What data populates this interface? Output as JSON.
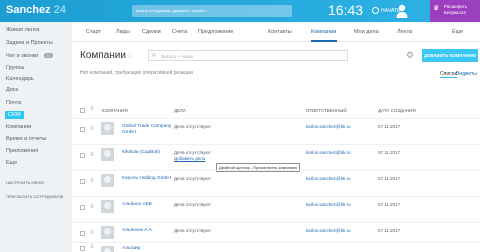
{
  "app": {
    "logo_name": "Sanchez",
    "logo_num": "24"
  },
  "header": {
    "search_placeholder": "искать сотрудника, документ, прочее...",
    "clock": "16:43",
    "start_label": "НАЧАТЬ",
    "extend_label": "Расширить Битрикс24"
  },
  "sidebar": {
    "items": [
      {
        "label": "Живая лента"
      },
      {
        "label": "Задачи и Проекты"
      },
      {
        "label": "Чат и звонки",
        "badge": "23"
      },
      {
        "label": "Группы"
      },
      {
        "label": "Календарь"
      },
      {
        "label": "Диск"
      },
      {
        "label": "Почта"
      },
      {
        "label": "CRM"
      },
      {
        "label": "Компании"
      },
      {
        "label": "Время и отчеты"
      },
      {
        "label": "Приложения"
      },
      {
        "label": "Еще"
      }
    ],
    "settings_label": "Настроить меню",
    "invite_label": "Пригласить сотрудников"
  },
  "nav": {
    "items": [
      "Старт",
      "Лиды",
      "Сделки",
      "Счета",
      "Предложение",
      "Контакты",
      "Компании",
      "Мои дела",
      "Лента",
      "Еще"
    ]
  },
  "page": {
    "title": "Компании",
    "filter_placeholder": "Фильтр + поиск",
    "add_button": "Добавить компанию",
    "notice": "Нет компаний, требующих оперативной реакции",
    "view_list": "Список",
    "view_forecast": "Виджеты"
  },
  "table": {
    "headers": [
      "Компания",
      "Дела",
      "Ответственный",
      "Дата создания"
    ],
    "rows": [
      {
        "name": "Global Trade Company GmbH",
        "deal": "Дела отсутствуют",
        "deal_link": "",
        "responsible": "karlos.sanchez@bk.ru",
        "date": "07.11.2017"
      },
      {
        "name": "Kikikola (CapBok)",
        "deal": "Дела отсутствуют",
        "deal_link": "Добавить дело",
        "responsible": "karlos.sanchez@bk.ru",
        "date": "07.11.2017"
      },
      {
        "name": "Король Holding GmbH",
        "deal": "Дела отсутствуют",
        "deal_link": "",
        "responsible": "karlos.sanchez@bk.ru",
        "date": "07.11.2017"
      },
      {
        "name": "Альбион АКБ",
        "deal": "Дела отсутствуют",
        "deal_link": "",
        "responsible": "karlos.sanchez@bk.ru",
        "date": "07.11.2017"
      },
      {
        "name": "Альянсик А.А.",
        "deal": "Дела отсутствуют",
        "deal_link": "",
        "responsible": "karlos.sanchez@bk.ru",
        "date": "07.11.2017"
      },
      {
        "name": "Альтаир",
        "deal": "Дела отсутствуют",
        "deal_link": "",
        "responsible": "karlos.sanchez@bk.ru",
        "date": "07.11.2017"
      }
    ],
    "tooltip": "Двойной щелчок - Просмотреть компанию"
  }
}
